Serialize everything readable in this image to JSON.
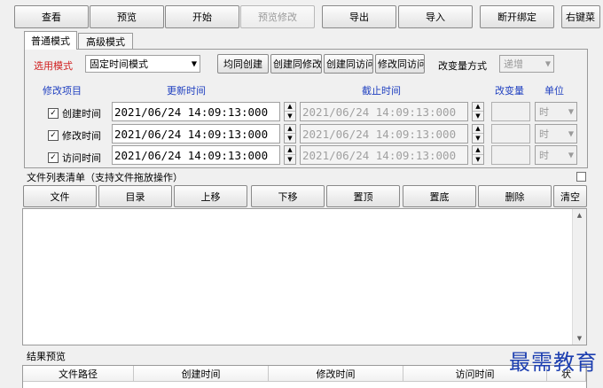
{
  "toolbar": {
    "view": "查看",
    "preview": "预览",
    "start": "开始",
    "preview_modify": "预览修改",
    "export": "导出",
    "import": "导入",
    "unbind": "断开绑定",
    "right_click": "右键菜"
  },
  "tabs": {
    "normal": "普通模式",
    "advanced": "高级模式"
  },
  "mode": {
    "label": "选用模式",
    "value": "固定时间模式",
    "buttons": [
      "均同创建",
      "创建同修改",
      "创建同访问",
      "修改同访问"
    ],
    "change_method_label": "改变量方式",
    "change_method_value": "递增"
  },
  "columns": {
    "item": "修改项目",
    "update_time": "更新时间",
    "end_time": "截止时间",
    "change_amount": "改变量",
    "unit": "单位"
  },
  "rows": [
    {
      "checked": "✓",
      "label": "创建时间",
      "update": "2021/06/24 14:09:13:000",
      "end": "2021/06/24 14:09:13:000",
      "unit": "时"
    },
    {
      "checked": "✓",
      "label": "修改时间",
      "update": "2021/06/24 14:09:13:000",
      "end": "2021/06/24 14:09:13:000",
      "unit": "时"
    },
    {
      "checked": "✓",
      "label": "访问时间",
      "update": "2021/06/24 14:09:13:000",
      "end": "2021/06/24 14:09:13:000",
      "unit": "时"
    }
  ],
  "file_list": {
    "title": "文件列表清单（支持文件拖放操作）",
    "buttons": [
      "文件",
      "目录",
      "上移",
      "下移",
      "置顶",
      "置底",
      "删除",
      "清空"
    ]
  },
  "results": {
    "title": "结果预览",
    "headers": [
      "文件路径",
      "创建时间",
      "修改时间",
      "访问时间",
      "状"
    ]
  },
  "watermark": "最需教育",
  "icons": {
    "checkbox": "check-icon",
    "spinner": "spin-arrows-icon",
    "dropdown": "chevron-down-icon"
  }
}
